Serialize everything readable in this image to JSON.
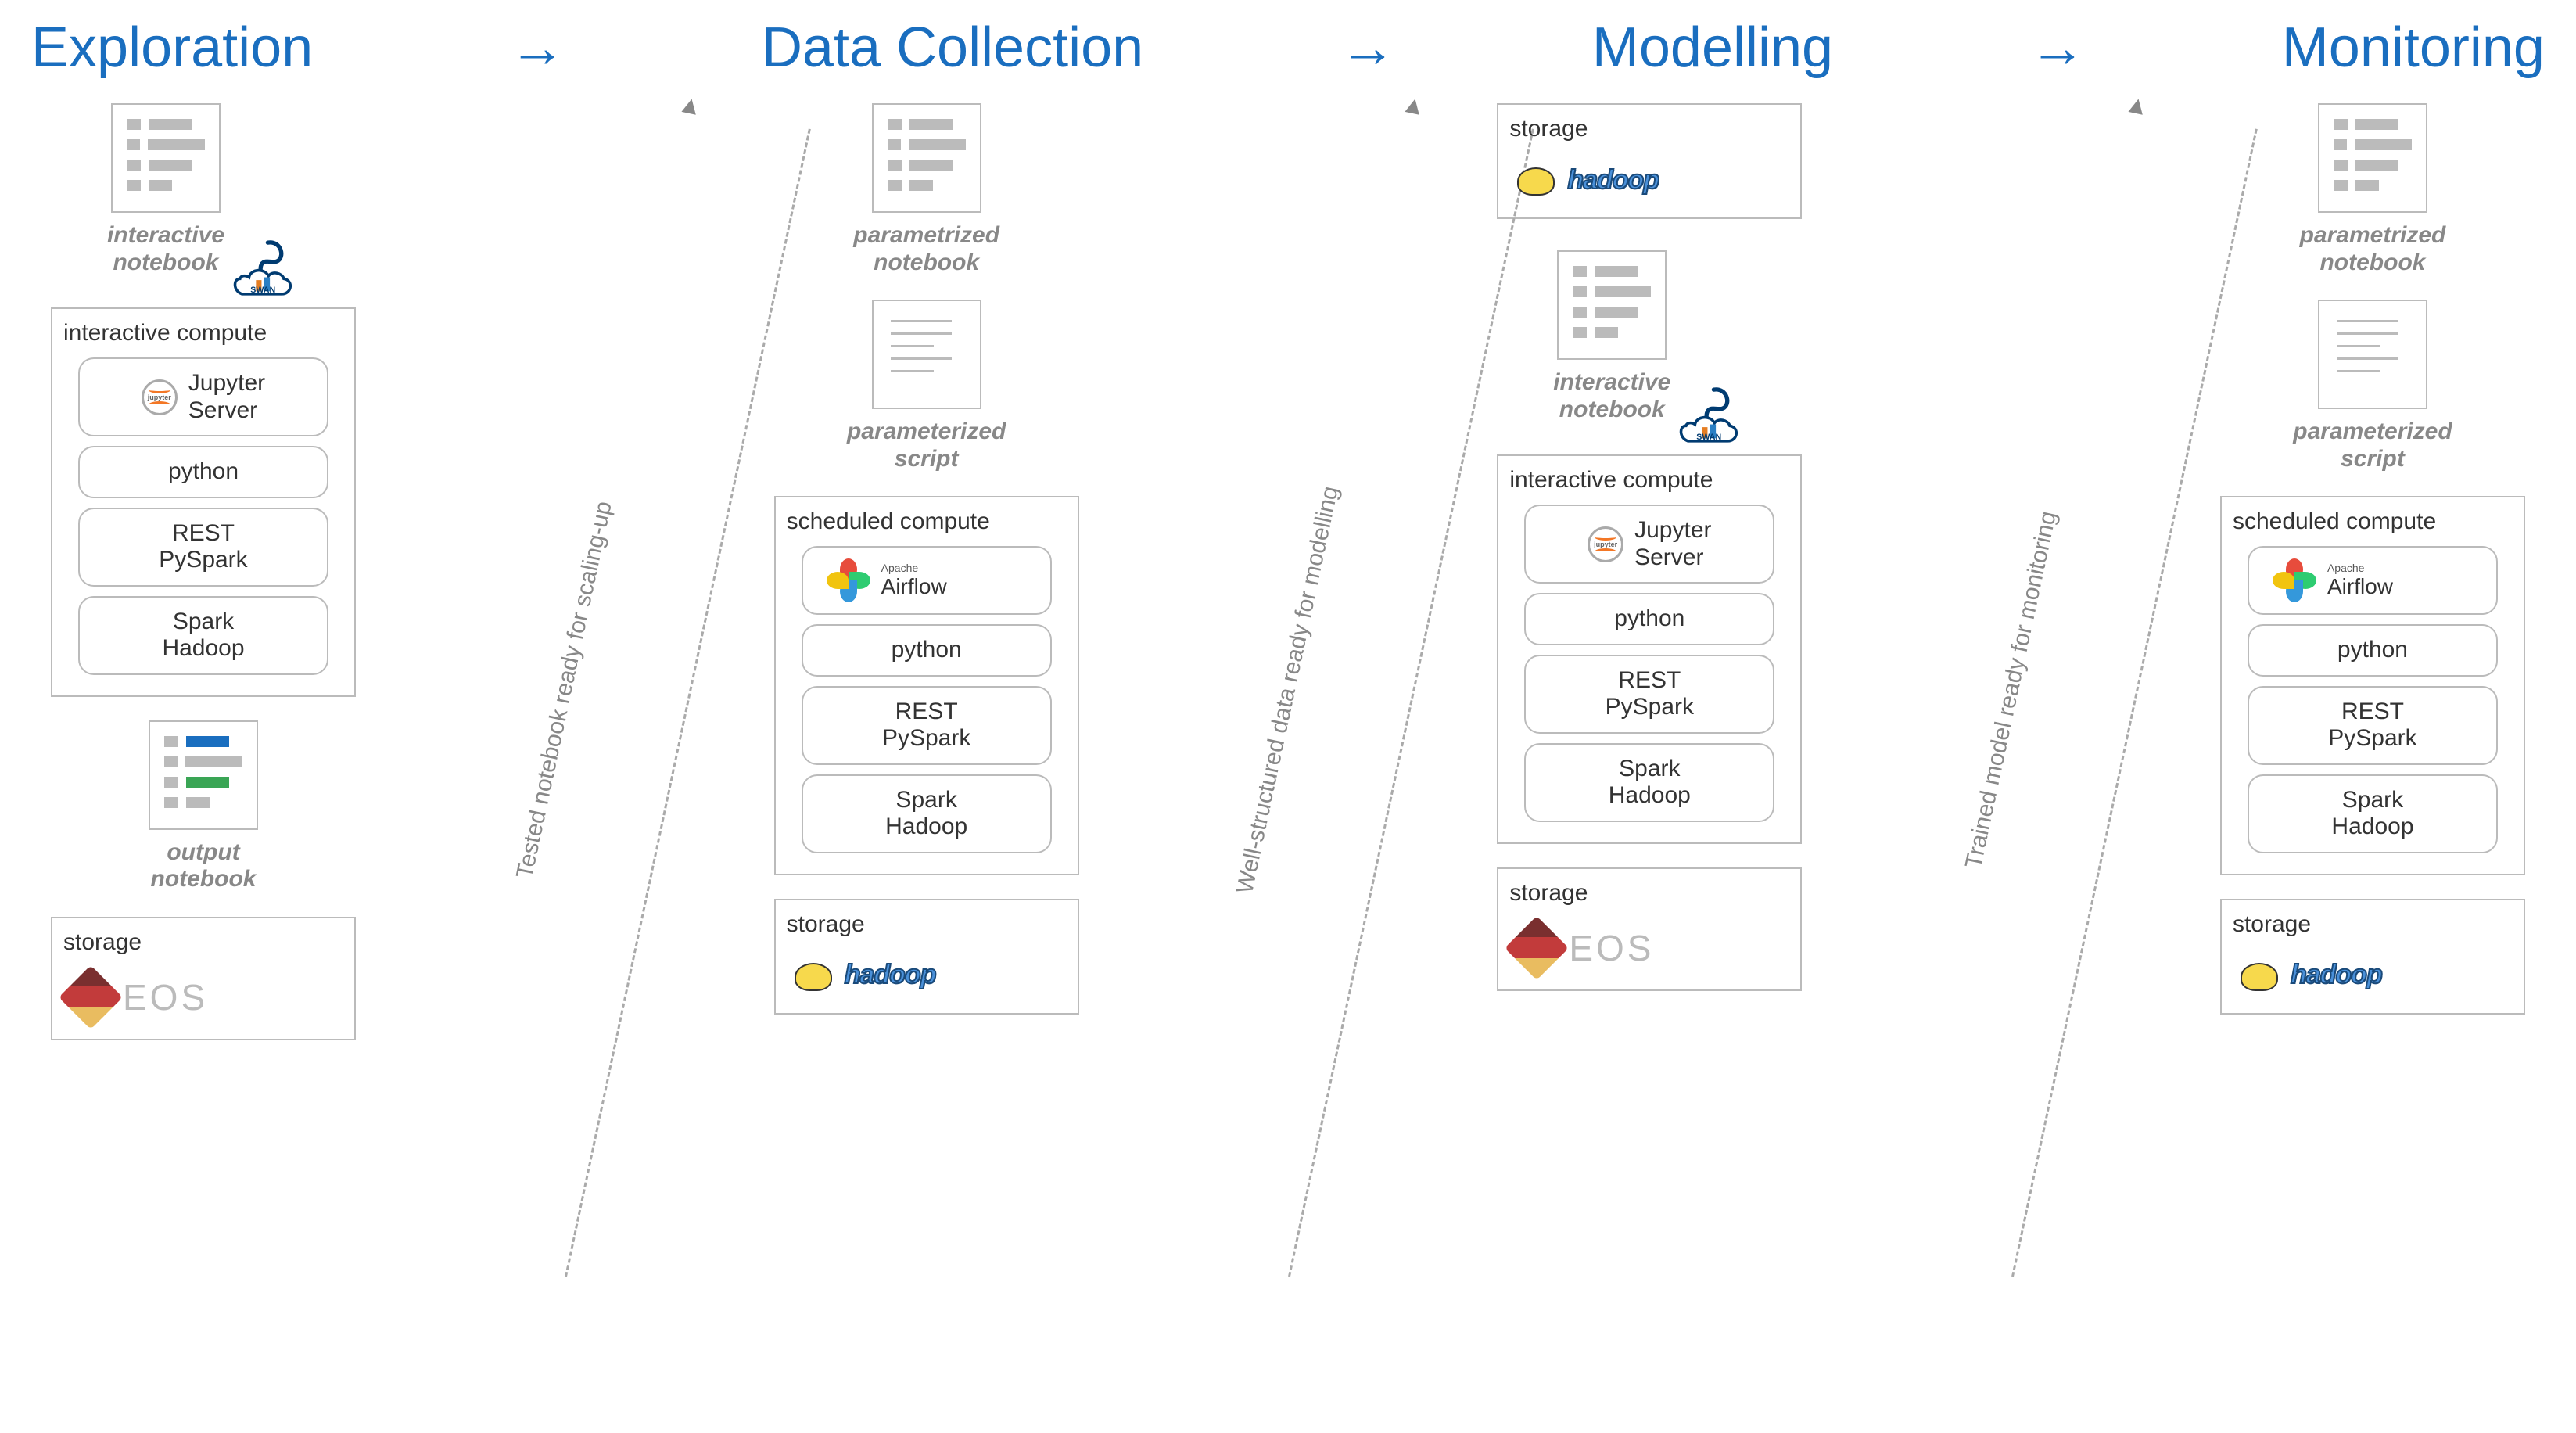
{
  "phases": {
    "exploration": "Exploration",
    "data_collection": "Data Collection",
    "modelling": "Modelling",
    "monitoring": "Monitoring"
  },
  "captions": {
    "interactive_notebook": "interactive\nnotebook",
    "parametrized_notebook": "parametrized\nnotebook",
    "parameterized_script": "parameterized\nscript",
    "output_notebook": "output\nnotebook"
  },
  "compute": {
    "interactive_title": "interactive compute",
    "scheduled_title": "scheduled compute",
    "jupyter": "Jupyter\nServer",
    "python": "python",
    "rest_pyspark": "REST\nPySpark",
    "spark_hadoop": "Spark\nHadoop",
    "airflow_small": "Apache",
    "airflow": "Airflow"
  },
  "storage": {
    "title": "storage",
    "eos": "EOS",
    "hadoop": "hadoop"
  },
  "transitions": {
    "t1": "Tested notebook ready for scaling-up",
    "t2": "Well-structured data ready for modelling",
    "t3": "Trained model ready for monitoring"
  },
  "icons": {
    "swan": "SWAN"
  }
}
